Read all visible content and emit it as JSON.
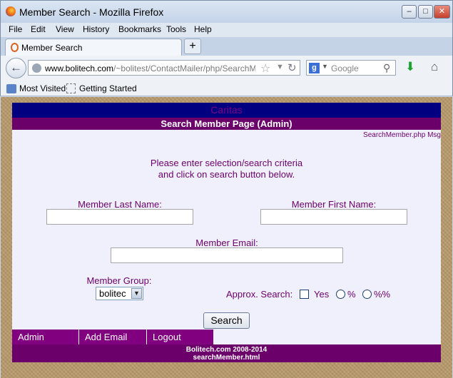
{
  "window": {
    "title": "Member Search - Mozilla Firefox"
  },
  "menu": [
    "File",
    "Edit",
    "View",
    "History",
    "Bookmarks",
    "Tools",
    "Help"
  ],
  "tab": {
    "label": "Member Search",
    "new_tab": "+"
  },
  "nav": {
    "url_domain": "www.bolitech.com",
    "url_path": "/~bolitest/ContactMailer/php/SearchMembe",
    "search_placeholder": "Google",
    "search_engine_icon": "g-icon"
  },
  "bookmarks": [
    "Most Visited",
    "Getting Started"
  ],
  "page": {
    "site_name": "Caritas",
    "page_title": "Search Member Page (Admin)",
    "msg_link": "SearchMember.php Msg",
    "instructions_line1": "Please enter selection/search criteria",
    "instructions_line2": "and click on search button below.",
    "last_name_label": "Member Last Name:",
    "last_name_value": "",
    "first_name_label": "Member First Name:",
    "first_name_value": "",
    "email_label": "Member Email:",
    "email_value": "",
    "group_label": "Member Group:",
    "group_selected": "bolitec",
    "approx_label": "Approx. Search:",
    "approx_yes": "Yes",
    "approx_pct": "%",
    "approx_pctpct": "%%",
    "search_button": "Search",
    "nav_links": [
      "Admin",
      "Add Email",
      "Logout"
    ],
    "footer_line1": "Bolitech.com 2008-2014",
    "footer_line2": "searchMember.html"
  },
  "colors": {
    "top_band": "#000080",
    "title_band": "#6b006b",
    "nav_band": "#800080",
    "text_purple": "#6b006b",
    "panel_bg": "#f0f0fc"
  }
}
